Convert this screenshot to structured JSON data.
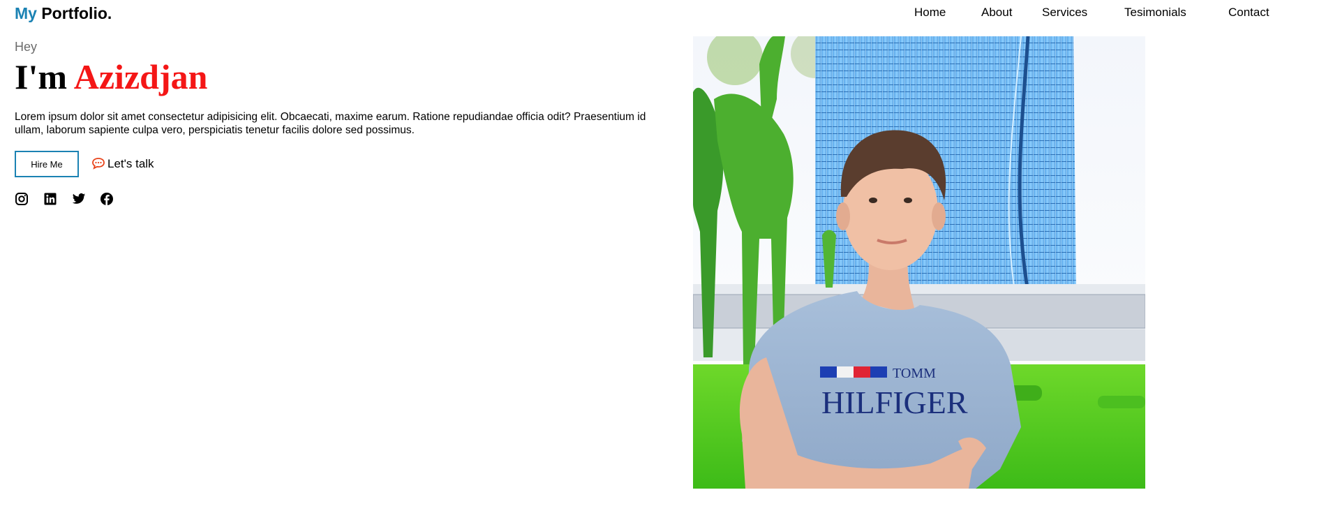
{
  "brand": {
    "accent": "My",
    "rest": "Portfolio.",
    "accent_color": "#1b82b3"
  },
  "nav": {
    "items": [
      {
        "label": "Home"
      },
      {
        "label": "About"
      },
      {
        "label": "Services"
      },
      {
        "label": "Tesimonials"
      },
      {
        "label": "Contact"
      }
    ]
  },
  "hero": {
    "greeting": "Hey",
    "headline_prefix": "I'm",
    "name": "Azizdjan",
    "name_color": "#f41616",
    "intro": "Lorem ipsum dolor sit amet consectetur adipisicing elit. Obcaecati, maxime earum. Ratione repudiandae officia odit? Praesentium id ullam, laborum sapiente culpa vero, perspiciatis tenetur facilis dolore sed possimus.",
    "hire_label": "Hire Me",
    "talk_label": "Let's talk",
    "talk_icon": "chat-bubble-icon",
    "talk_icon_color": "#e8431a"
  },
  "social": [
    "instagram-icon",
    "linkedin-icon",
    "twitter-icon",
    "facebook-icon"
  ],
  "photo": {
    "shirt_text_top": "TOMM",
    "shirt_text_main": "HILFIGER"
  }
}
